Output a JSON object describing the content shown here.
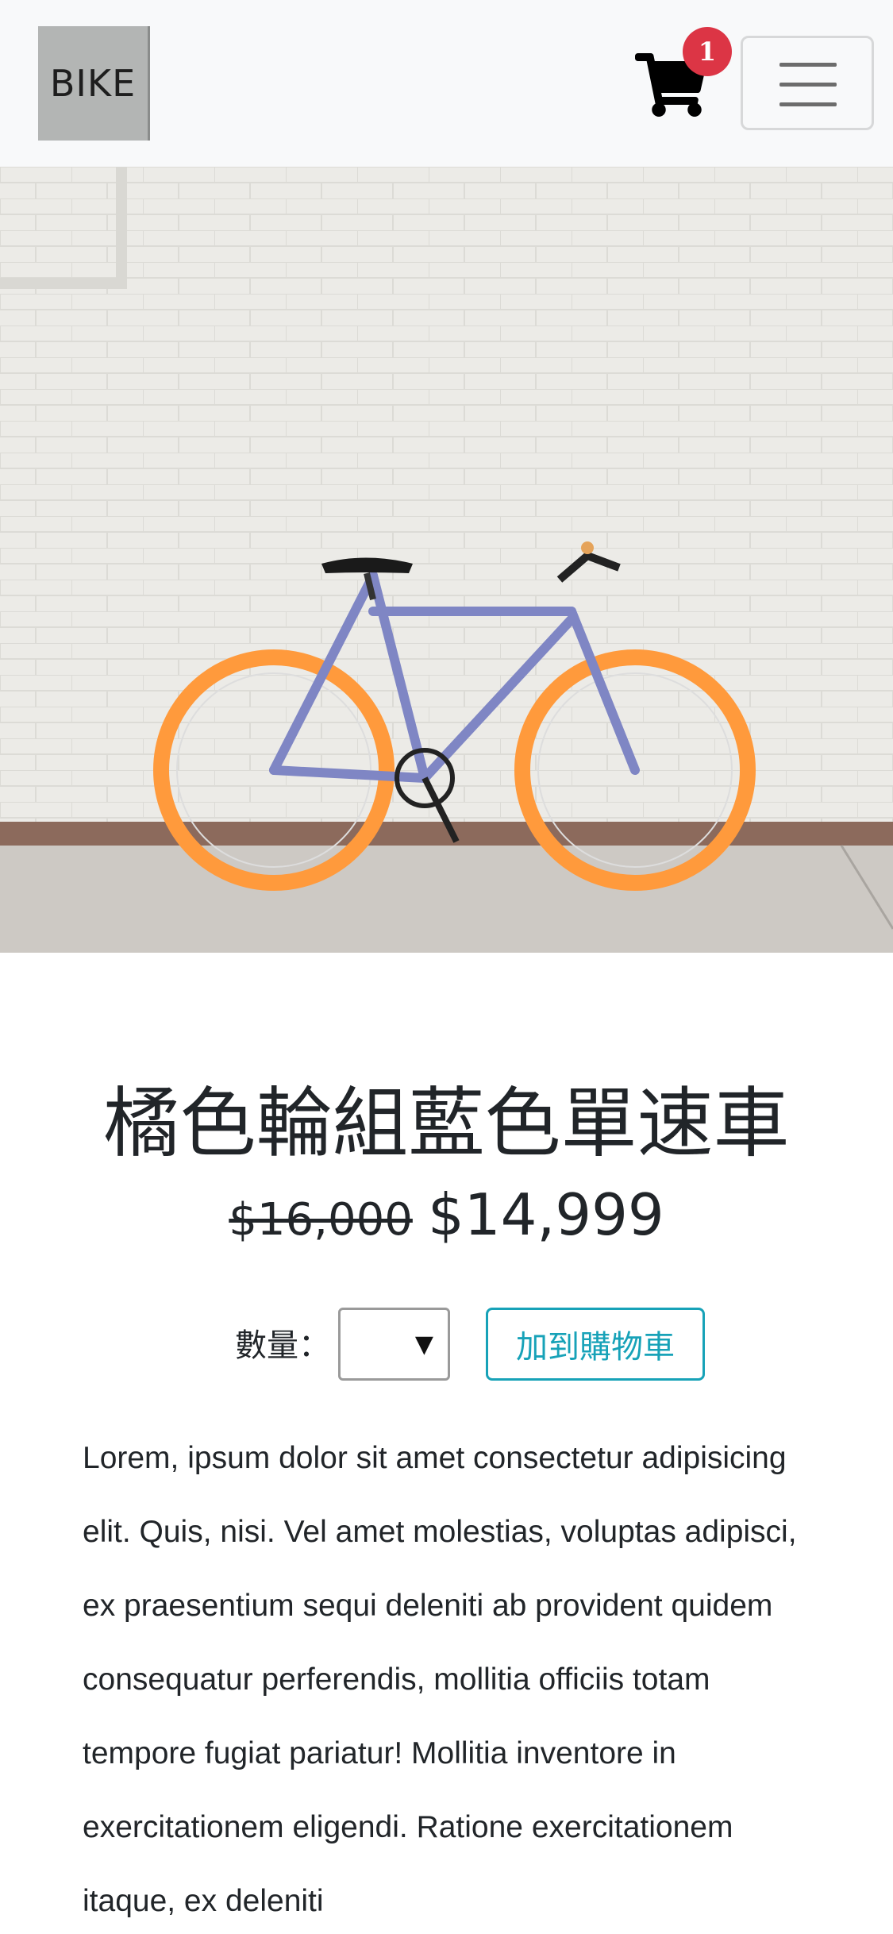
{
  "navbar": {
    "brand": "BIKE",
    "cart_count": "1",
    "cart_icon": "shopping-cart-icon",
    "menu_icon": "hamburger-menu-icon"
  },
  "hero": {
    "image": "orange-wheel-blue-bicycle-photo",
    "colors": {
      "frame": "#7f86c4",
      "wheels": "#ff9a3c",
      "wall": "#ededea"
    }
  },
  "product": {
    "title": "橘色輪組藍色單速車",
    "old_price": "$16,000",
    "price": "$14,999",
    "quantity_label": "數量：",
    "quantity_value": "",
    "add_to_cart": "加到購物車",
    "description": "Lorem, ipsum dolor sit amet consectetur adipisicing elit. Quis, nisi. Vel amet molestias, voluptas adipisci, ex praesentium sequi deleniti ab provident quidem consequatur perferendis, mollitia officiis totam tempore fugiat pariatur! Mollitia inventore in exercitationem eligendi. Ratione exercitationem itaque, ex deleniti"
  },
  "colors": {
    "accent": "#17a2b8",
    "badge": "#dc3545",
    "navbar_bg": "#f8f9fa"
  }
}
